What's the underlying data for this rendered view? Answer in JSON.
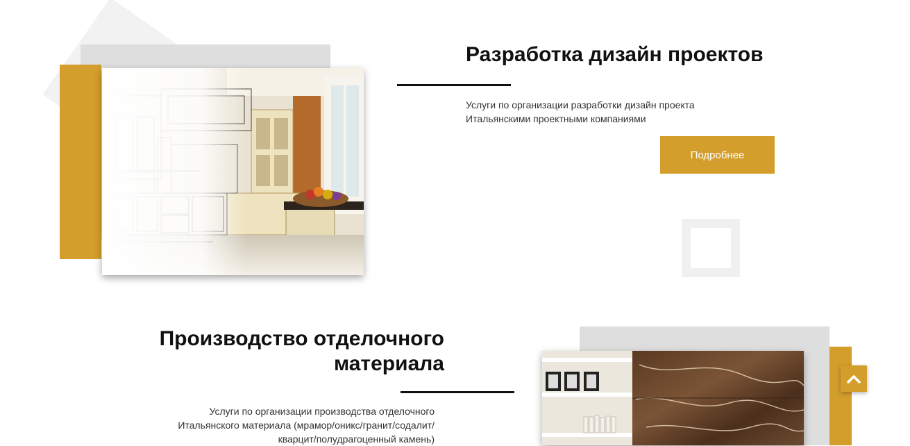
{
  "sections": [
    {
      "title": "Разработка дизайн проектов",
      "description_lines": [
        "Услуги по организации разработки дизайн проекта",
        "Итальянскими проектными компаниями"
      ],
      "button_label": "Подробнее",
      "image_subject": "kitchen sketch to photo"
    },
    {
      "title_lines": [
        "Производство отделочного",
        "материала"
      ],
      "description_lines": [
        "Услуги по организации производства отделочного",
        "Итальянского материала (мрамор/оникс/гранит/содалит/",
        "кварцит/полудрагоценный камень)"
      ],
      "image_subject": "marble interior"
    }
  ],
  "scroll_top": {
    "icon": "chevron-up-icon"
  },
  "colors": {
    "accent": "#d49e2c",
    "gray_block": "#dedede",
    "light_shape": "#f2f2f2",
    "text": "#111111"
  }
}
